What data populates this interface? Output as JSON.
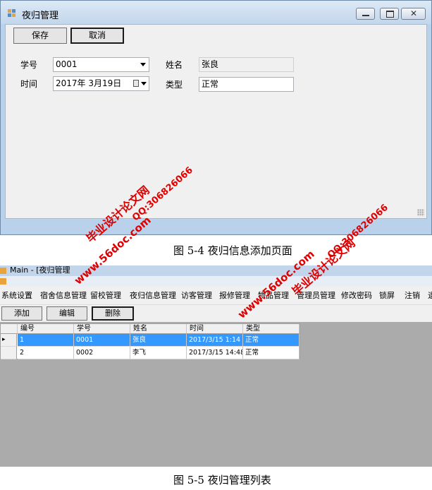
{
  "form": {
    "title": "夜归管理",
    "save_label": "保存",
    "cancel_label": "取消",
    "student_id_label": "学号",
    "student_id_value": "0001",
    "name_label": "姓名",
    "name_value": "张良",
    "time_label": "时间",
    "time_value": "2017年  3月19日",
    "type_label": "类型",
    "type_value": "正常"
  },
  "caption1": "图 5-4 夜归信息添加页面",
  "main": {
    "title": "Main - [夜归管理",
    "menu": [
      "系统设置",
      "宿舍信息管理",
      "留校管理",
      "夜归信息管理",
      "访客管理",
      "报修管理",
      "物品管理",
      "管理员管理",
      "修改密码",
      "锁屏",
      "注销",
      "退"
    ],
    "toolbar": {
      "add_label": "添加",
      "edit_label": "编辑",
      "delete_label": "删除"
    },
    "table": {
      "columns": [
        "编号",
        "学号",
        "姓名",
        "时间",
        "类型"
      ],
      "rows": [
        [
          "1",
          "0001",
          "张良",
          "2017/3/15  1:14",
          "正常"
        ],
        [
          "2",
          "0002",
          "李飞",
          "2017/3/15 14:48",
          "正常"
        ]
      ]
    }
  },
  "caption2": "图 5-5 夜归管理列表",
  "watermarks": {
    "site": "www.56doc.com",
    "qq": "QQ:306826066",
    "brand": "毕业设计论文网"
  },
  "colors": {
    "selection": "#3399ff",
    "watermark": "#e00000",
    "title_bar": "#c2d5ea"
  }
}
